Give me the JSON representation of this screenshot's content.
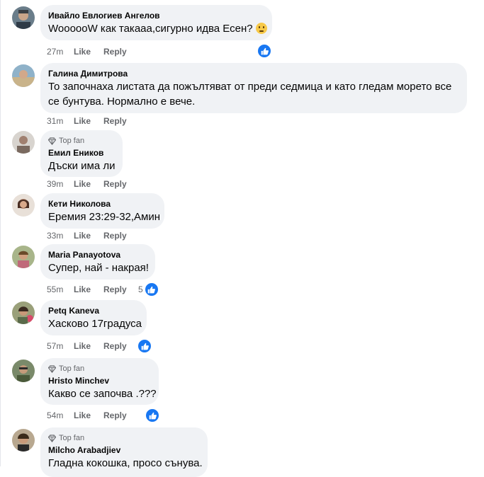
{
  "comments": [
    {
      "author": "Ивайло Евлогиев Ангелов",
      "text": "WoooooW как такааа,сигурно идва Есен?",
      "time": "27m",
      "like": "Like",
      "reply": "Reply",
      "top_fan": "",
      "reactions": ""
    },
    {
      "author": "Галина Димитрова",
      "text": "То започнаха листата да пожълтяват от преди седмица и като гледам морето все се бунтува. Нормално е вече.",
      "time": "31m",
      "like": "Like",
      "reply": "Reply",
      "top_fan": "",
      "reactions": ""
    },
    {
      "author": "Емил Еников",
      "text": "Дъски има ли",
      "time": "39m",
      "like": "Like",
      "reply": "Reply",
      "top_fan": "Top fan",
      "reactions": ""
    },
    {
      "author": "Кети Николова",
      "text": "Еремия 23:29-32,Амин",
      "time": "33m",
      "like": "Like",
      "reply": "Reply",
      "top_fan": "",
      "reactions": ""
    },
    {
      "author": "Maria Panayotova",
      "text": "Супер, най - накрая!",
      "time": "55m",
      "like": "Like",
      "reply": "Reply",
      "top_fan": "",
      "reactions": "5"
    },
    {
      "author": "Petq Kaneva",
      "text": "Хасково 17градуса",
      "time": "57m",
      "like": "Like",
      "reply": "Reply",
      "top_fan": "",
      "reactions": ""
    },
    {
      "author": "Hristo Minchev",
      "text": "Какво се започва .???",
      "time": "54m",
      "like": "Like",
      "reply": "Reply",
      "top_fan": "Top fan",
      "reactions": ""
    },
    {
      "author": "Milcho Arabadjiev",
      "text": "Гладна кокошка, просо сънува.",
      "time": "",
      "like": "",
      "reply": "",
      "top_fan": "Top fan",
      "reactions": ""
    }
  ],
  "colors": {
    "bubble": "#f0f2f5",
    "meta": "#65676b",
    "like_blue": "#1877f2"
  }
}
